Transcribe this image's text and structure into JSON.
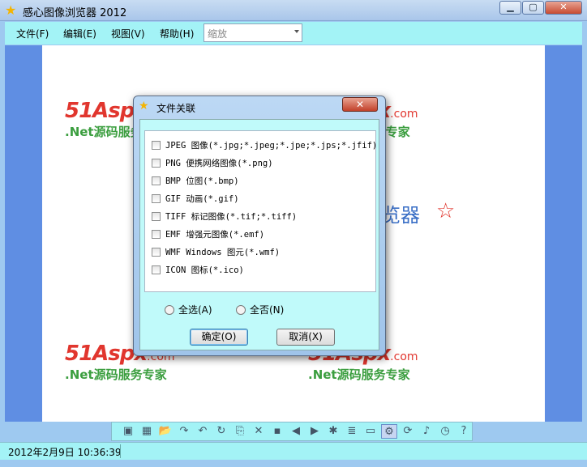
{
  "window": {
    "title": "感心图像浏览器 2012"
  },
  "menu": {
    "items": [
      "文件(F)",
      "编辑(E)",
      "视图(V)",
      "帮助(H)"
    ],
    "zoom_value": "缩放"
  },
  "canvas": {
    "watermark_logo": "51Aspx",
    "watermark_domain": ".com",
    "watermark_tagline": ".Net源码服务专家",
    "heading_fragment": "览器",
    "heading_star": "☆"
  },
  "dialog": {
    "title": "文件关联",
    "close_label": "✕",
    "file_types": [
      "JPEG 图像(*.jpg;*.jpeg;*.jpe;*.jps;*.jfif)",
      "PNG 便携网络图像(*.png)",
      "BMP 位图(*.bmp)",
      "GIF 动画(*.gif)",
      "TIFF 标记图像(*.tif;*.tiff)",
      "EMF 增强元图像(*.emf)",
      "WMF Windows 图元(*.wmf)",
      "ICON 图标(*.ico)"
    ],
    "select_all": "全选(A)",
    "select_none": "全否(N)",
    "ok_label": "确定(O)",
    "cancel_label": "取消(X)"
  },
  "toolbar": {
    "icons": [
      "image-open-icon",
      "color-icon",
      "folder-open-icon",
      "redo-icon",
      "undo-icon",
      "rotate-icon",
      "copy-icon",
      "delete-icon",
      "save-icon",
      "prev-icon",
      "next-icon",
      "slideshow-icon",
      "list-icon",
      "window-icon",
      "network-icon",
      "refresh-icon",
      "music-icon",
      "clock-icon",
      "help-icon"
    ],
    "glyphs": [
      "▣",
      "▦",
      "📂",
      "↷",
      "↶",
      "↻",
      "⎘",
      "✕",
      "▪",
      "◀",
      "▶",
      "✱",
      "≣",
      "▭",
      "⚙",
      "⟳",
      "♪",
      "◷",
      "?"
    ]
  },
  "status": {
    "datetime": "2012年2月9日 10:36:39"
  }
}
